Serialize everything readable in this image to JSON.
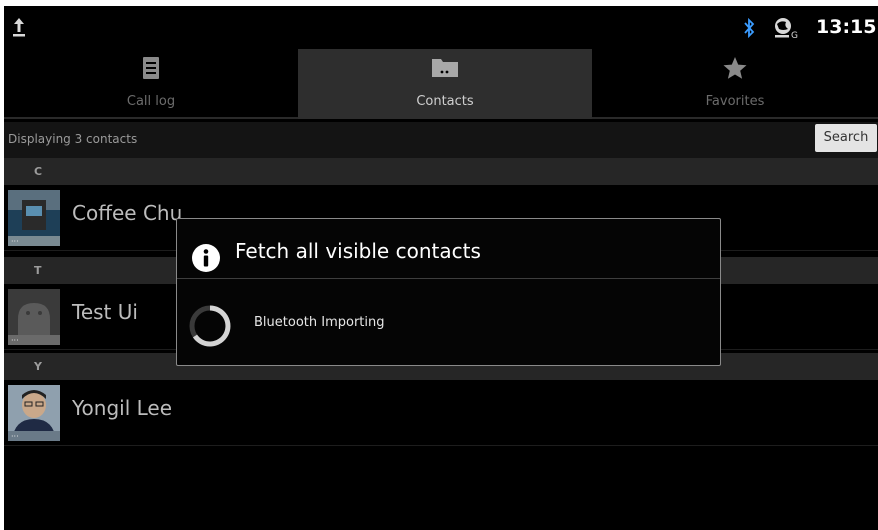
{
  "status_bar": {
    "time": "13:15",
    "icons": [
      "upload-icon",
      "bluetooth-icon",
      "sync-icon"
    ]
  },
  "tabs": [
    {
      "label": "Call log",
      "icon": "call-log-icon",
      "active": false
    },
    {
      "label": "Contacts",
      "icon": "contacts-icon",
      "active": true
    },
    {
      "label": "Favorites",
      "icon": "star-icon",
      "active": false
    }
  ],
  "list_header": {
    "count_text": "Displaying 3 contacts",
    "search_label": "Search"
  },
  "sections": [
    {
      "letter": "C",
      "contacts": [
        {
          "name": "Coffee Chu"
        }
      ]
    },
    {
      "letter": "T",
      "contacts": [
        {
          "name": "Test Ui"
        }
      ]
    },
    {
      "letter": "Y",
      "contacts": [
        {
          "name": "Yongil Lee"
        }
      ]
    }
  ],
  "dialog": {
    "title": "Fetch all visible contacts",
    "message": "Bluetooth Importing",
    "icon": "info-icon"
  },
  "colors": {
    "background": "#000000",
    "active_tab": "#2e2e2e",
    "section_header": "#262626",
    "bluetooth": "#3b9cff"
  }
}
